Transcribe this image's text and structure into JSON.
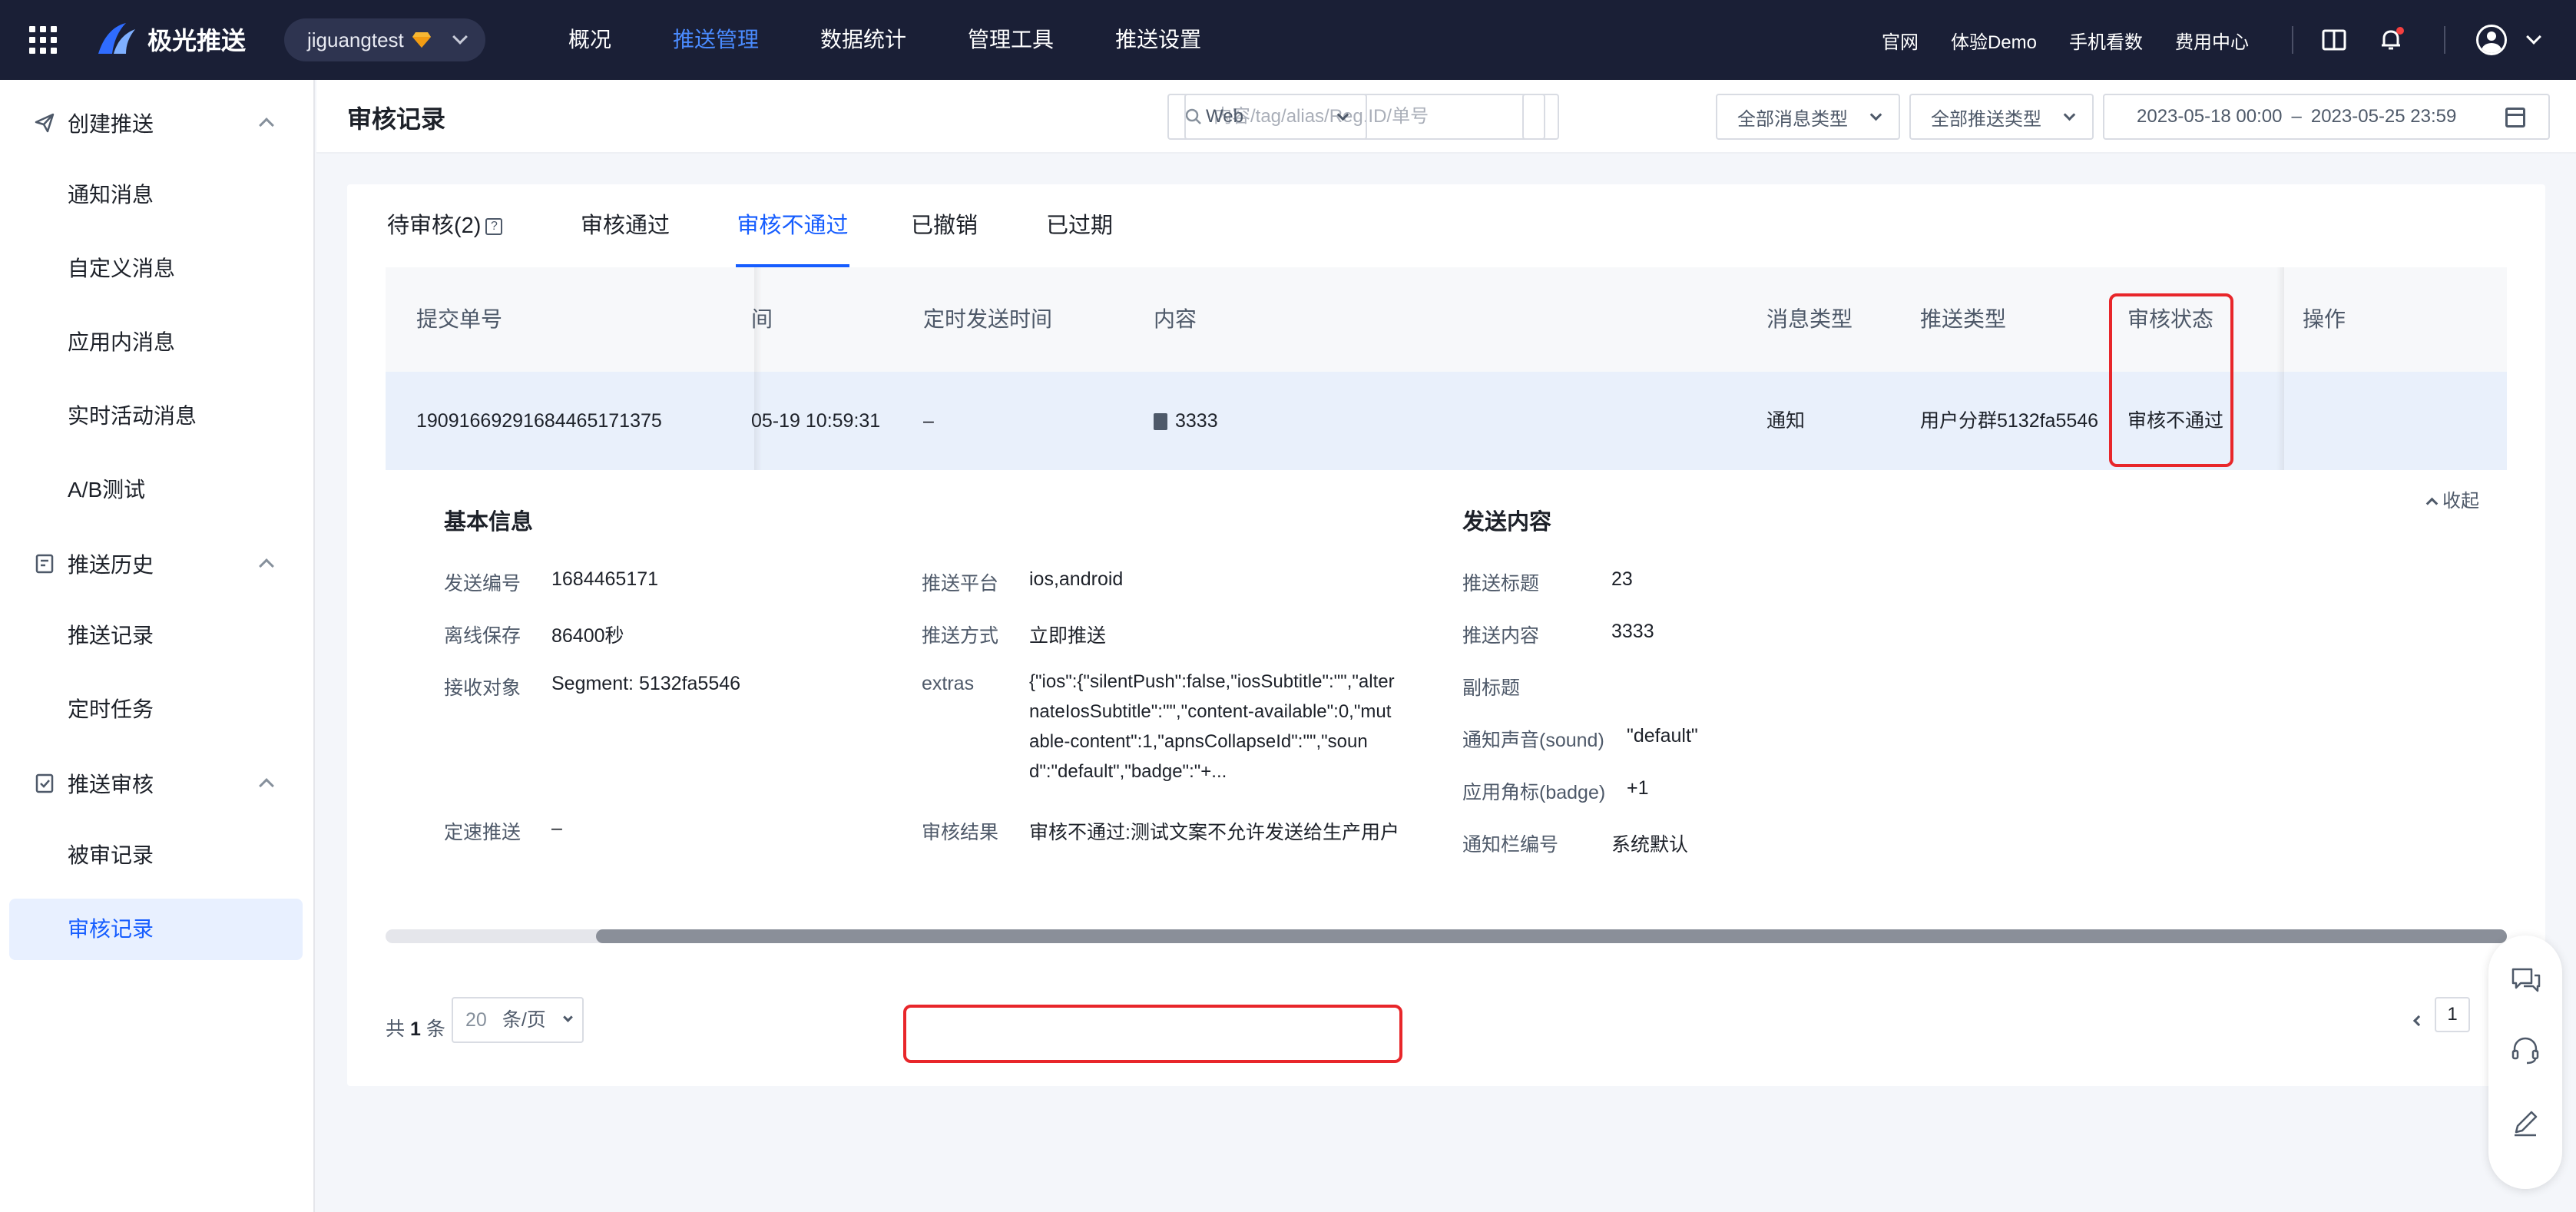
{
  "topbar": {
    "logo_text": "极光推送",
    "app_name": "jiguangtest",
    "nav": [
      "概况",
      "推送管理",
      "数据统计",
      "管理工具",
      "推送设置"
    ],
    "active_nav_index": 1,
    "links": [
      "官网",
      "体验Demo",
      "手机看数",
      "费用中心"
    ],
    "accent_color": "#4a8bff"
  },
  "sidebar": {
    "groups": [
      {
        "label": "创建推送",
        "icon": "send-icon",
        "items": [
          "通知消息",
          "自定义消息",
          "应用内消息",
          "实时活动消息",
          "A/B测试"
        ]
      },
      {
        "label": "推送历史",
        "icon": "history-icon",
        "items": [
          "推送记录",
          "定时任务"
        ]
      },
      {
        "label": "推送审核",
        "icon": "audit-icon",
        "items": [
          "被审记录",
          "审核记录"
        ]
      }
    ],
    "active_item": "审核记录"
  },
  "header": {
    "title": "审核记录",
    "search_placeholder": "内容/tag/alias/Reg.ID/单号",
    "platform": "Web",
    "msg_type": "全部消息类型",
    "push_type": "全部推送类型",
    "date_start": "2023-05-18 00:00",
    "date_sep": "–",
    "date_end": "2023-05-25 23:59"
  },
  "tabs": {
    "items": [
      "待审核(2)",
      "审核通过",
      "审核不通过",
      "已撤销",
      "已过期"
    ],
    "active_index": 2,
    "help_glyph": "?"
  },
  "table": {
    "columns": [
      "提交单号",
      "间",
      "定时发送时间",
      "内容",
      "消息类型",
      "推送类型",
      "审核状态",
      "操作"
    ],
    "row": {
      "order_no": "19091669291684465171375",
      "time": "05-19 10:59:31",
      "scheduled": "–",
      "content": "3333",
      "msg_type": "通知",
      "push_type": "用户分群5132fa5546",
      "status": "审核不通过",
      "action": ""
    }
  },
  "detail": {
    "collapse_label": "收起",
    "basic_title": "基本信息",
    "send_title": "发送内容",
    "basic": [
      {
        "label": "发送编号",
        "value": "1684465171"
      },
      {
        "label": "离线保存",
        "value": "86400秒"
      },
      {
        "label": "接收对象",
        "value": "Segment: 5132fa5546"
      },
      {
        "label": "定速推送",
        "value": "–"
      }
    ],
    "mid": [
      {
        "label": "推送平台",
        "value": "ios,android"
      },
      {
        "label": "推送方式",
        "value": "立即推送"
      },
      {
        "label": "extras",
        "value": "{\"ios\":{\"silentPush\":false,\"iosSubtitle\":\"\",\"alternateIosSubtitle\":\"\",\"content-available\":0,\"mutable-content\":1,\"apnsCollapseId\":\"\",\"sound\":\"default\",\"badge\":\"+..."
      },
      {
        "label": "审核结果",
        "value": "审核不通过:测试文案不允许发送给生产用户"
      }
    ],
    "content": [
      {
        "label": "推送标题",
        "value": "23"
      },
      {
        "label": "推送内容",
        "value": "3333"
      },
      {
        "label": "副标题",
        "value": ""
      },
      {
        "label": "通知声音(sound)",
        "value": "\"default\""
      },
      {
        "label": "应用角标(badge)",
        "value": "+1"
      },
      {
        "label": "通知栏编号",
        "value": "系统默认"
      }
    ]
  },
  "pagination": {
    "total_prefix": "共",
    "total": "1",
    "total_suffix": "条",
    "page_size": "20",
    "page_size_unit": "条/页",
    "current_page": "1"
  }
}
